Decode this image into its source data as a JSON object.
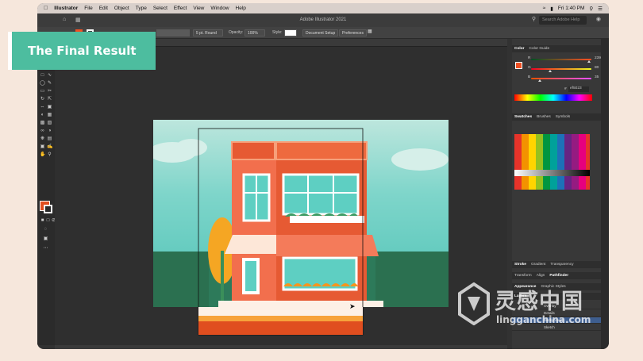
{
  "badge": {
    "text": "The Final Result"
  },
  "menubar": {
    "app": "Illustrator",
    "items": [
      "File",
      "Edit",
      "Object",
      "Type",
      "Select",
      "Effect",
      "View",
      "Window",
      "Help"
    ],
    "clock": "Fri 1:40 PM"
  },
  "titlebar": {
    "title": "Adobe Illustrator 2021",
    "search_placeholder": "Search Adobe Help"
  },
  "control": {
    "stroke_profile": "5 pt. Round",
    "opacity_label": "Opacity:",
    "opacity_value": "100%",
    "style_label": "Style:",
    "doc_setup": "Document Setup",
    "preferences": "Preferences"
  },
  "color_panel": {
    "tabs": [
      "Color",
      "Color Guide"
    ],
    "r": {
      "label": "R",
      "value": "239"
    },
    "g": {
      "label": "G",
      "value": "80"
    },
    "b": {
      "label": "B",
      "value": "35"
    },
    "hex": "ef5023"
  },
  "swatches_panel": {
    "tabs": [
      "Swatches",
      "Brushes",
      "Symbols"
    ]
  },
  "stroke_panel": {
    "tabs": [
      "Stroke",
      "Gradient",
      "Transparency"
    ]
  },
  "transform_panel": {
    "tabs": [
      "Transform",
      "Align",
      "Pathfinder"
    ]
  },
  "appearance_panel": {
    "tabs": [
      "Appearance",
      "Graphic Styles"
    ]
  },
  "layers_panel": {
    "tab": "Layers",
    "layers": [
      "Overlay",
      "Details",
      "Background",
      "Sketch"
    ]
  },
  "watermark": {
    "text1": "灵感中国",
    "text2": "lingganchina.com"
  },
  "colors": {
    "accent": "#ef5023",
    "badge": "#4dbd9f",
    "artboard_bg": "#7ed5ca"
  }
}
